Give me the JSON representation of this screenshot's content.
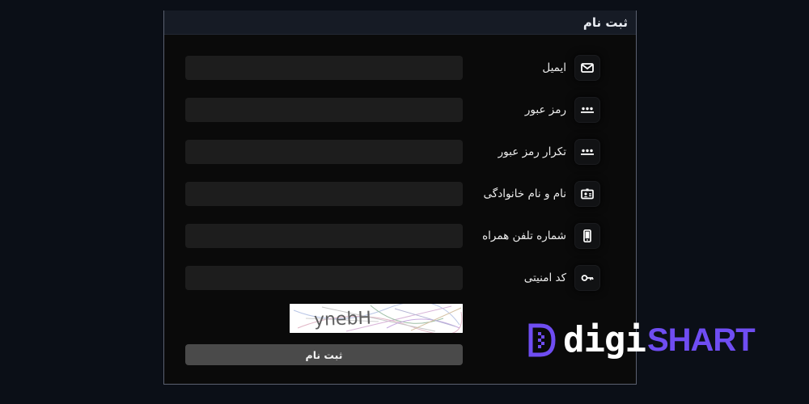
{
  "form": {
    "title": "ثبت نام",
    "fields": [
      {
        "label": "ایمیل",
        "icon": "envelope-icon",
        "value": "",
        "placeholder": ""
      },
      {
        "label": "رمز عبور",
        "icon": "password-dots-icon",
        "value": "",
        "placeholder": ""
      },
      {
        "label": "تکرار رمز عبور",
        "icon": "password-dots-icon",
        "value": "",
        "placeholder": ""
      },
      {
        "label": "نام و نام خانوادگی",
        "icon": "id-card-icon",
        "value": "",
        "placeholder": ""
      },
      {
        "label": "شماره تلفن همراه",
        "icon": "mobile-phone-icon",
        "value": "",
        "placeholder": ""
      },
      {
        "label": "کد امنیتی",
        "icon": "key-icon",
        "value": "",
        "placeholder": ""
      }
    ],
    "captcha_text": "ynebH",
    "submit_label": "ثبت نام"
  },
  "brand": {
    "part1": "digi",
    "part2": "SHART",
    "colors": {
      "part1": "#ffffff",
      "part2": "#6f4df2"
    }
  },
  "colors": {
    "page_bg": "#0b0f17",
    "panel_bg": "#0a0a0a",
    "header_bg": "#161b25",
    "input_bg": "#1d1d1d",
    "button_bg": "#4a4a4a"
  }
}
